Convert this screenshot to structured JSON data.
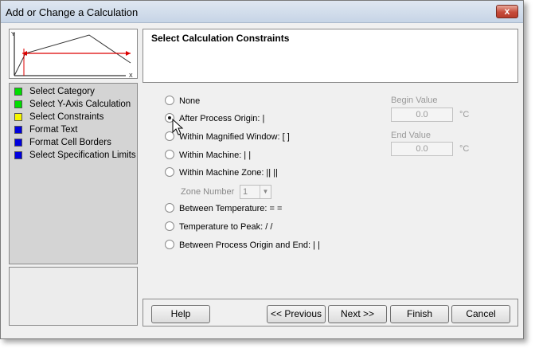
{
  "window": {
    "title": "Add or Change a Calculation",
    "close_label": "x"
  },
  "preview": {
    "y_label": "Y",
    "x_label": "X"
  },
  "steps": [
    {
      "label": "Select Category",
      "color": "#00dd00"
    },
    {
      "label": "Select Y-Axis Calculation",
      "color": "#00dd00"
    },
    {
      "label": "Select Constraints",
      "color": "#f5f500"
    },
    {
      "label": "Format Text",
      "color": "#0000dd"
    },
    {
      "label": "Format Cell Borders",
      "color": "#0000dd"
    },
    {
      "label": "Select Specification Limits",
      "color": "#0000dd"
    }
  ],
  "header": {
    "title": "Select Calculation Constraints"
  },
  "options": [
    {
      "label": "None",
      "checked": false
    },
    {
      "label": "After Process Origin: |",
      "checked": true
    },
    {
      "label": "Within Magnified Window: [ ]",
      "checked": false
    },
    {
      "label": "Within Machine: |  |",
      "checked": false
    },
    {
      "label": "Within Machine Zone: ||  ||",
      "checked": false
    },
    {
      "label": "Between Temperature: =  =",
      "checked": false
    },
    {
      "label": "Temperature to Peak: /  /",
      "checked": false
    },
    {
      "label": "Between Process Origin and End: |  |",
      "checked": false
    }
  ],
  "zone": {
    "label": "Zone Number",
    "value": "1"
  },
  "begin": {
    "label": "Begin Value",
    "value": "0.0",
    "unit": "°C"
  },
  "end": {
    "label": "End Value",
    "value": "0.0",
    "unit": "°C"
  },
  "buttons": {
    "help": "Help",
    "previous": "<< Previous",
    "next": "Next >>",
    "finish": "Finish",
    "cancel": "Cancel"
  }
}
